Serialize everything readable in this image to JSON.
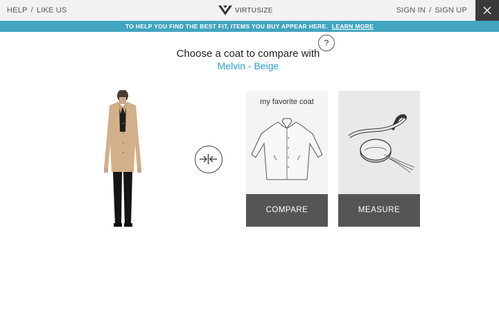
{
  "header": {
    "help_label": "HELP",
    "separator": "/",
    "like_label": "LIKE US",
    "brand_name": "VIRTUSIZE",
    "signin_label": "SIGN IN",
    "signup_label": "SIGN UP",
    "close_icon": "close-icon"
  },
  "banner": {
    "text": "TO HELP YOU FIND THE BEST FIT, ITEMS YOU BUY APPEAR HERE.",
    "link": "LEARN MORE",
    "color": "#42a5c0"
  },
  "main": {
    "title": "Choose a coat to compare with",
    "product_name": "Melvin - Beige",
    "help_symbol": "?"
  },
  "cards": [
    {
      "label": "my favorite coat",
      "button": "COMPARE",
      "icon": "coat-outline-icon"
    },
    {
      "label": "",
      "button": "MEASURE",
      "icon": "measuring-tape-icon"
    }
  ],
  "colors": {
    "accent": "#2a9fd0",
    "button": "#555555",
    "topbar": "#f2f2f2"
  }
}
